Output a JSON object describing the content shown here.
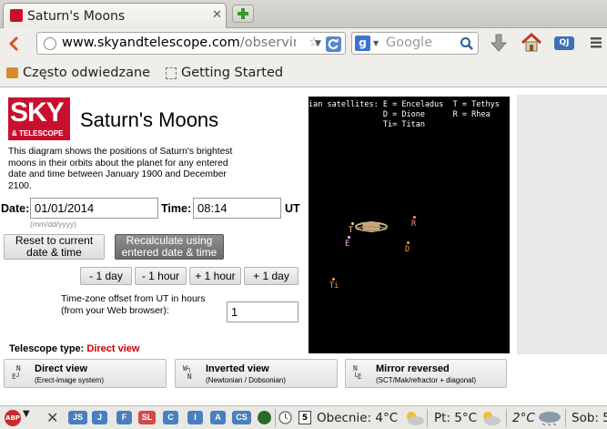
{
  "browser": {
    "tab_title": "Saturn's Moons",
    "url_host": "www.skyandtelescope.com",
    "url_path": "/observir",
    "search_placeholder": "Google",
    "bookmarks": [
      "Często odwiedzane",
      "Getting Started"
    ],
    "toolbar_badge": "QJ"
  },
  "page": {
    "logo_top": "SKY",
    "logo_bottom": "& TELESCOPE",
    "title": "Saturn's Moons",
    "description": "This diagram shows the positions of Saturn's brightest moons in their orbits about the planet for any entered date and time between January 1900 and December 2100.",
    "date_label": "Date:",
    "date_value": "01/01/2014",
    "date_hint": "(mm/dd/yyyy)",
    "time_label": "Time:",
    "time_value": "08:14",
    "time_unit": "UT",
    "reset_button": "Reset to current date & time",
    "recalc_button": "Recalculate using entered date & time",
    "step_buttons": [
      "- 1 day",
      "- 1 hour",
      "+ 1 hour",
      "+ 1 day"
    ],
    "tz_label": "Time-zone offset from UT in hours (from your Web browser):",
    "tz_value": "1",
    "scope_type_label": "Telescope type:",
    "scope_type_value": "Direct view",
    "view_buttons": [
      {
        "title": "Direct view",
        "sub": "(Erect-image system)"
      },
      {
        "title": "Inverted view",
        "sub": "(Newtonian / Dobsonian)"
      },
      {
        "title": "Mirror reversed",
        "sub": "(SCT/Mak/refractor + diagonal)"
      }
    ]
  },
  "sky_plot": {
    "legend_lines": [
      "ian satellites: E = Enceladus  T = Tethys",
      "                D = Dione      R = Rhea",
      "                Ti= Titan"
    ],
    "moons": [
      {
        "label": "T",
        "color": "#ffd27a"
      },
      {
        "label": "E",
        "color": "#ffb0ff"
      },
      {
        "label": "R",
        "color": "#ff8a8a"
      },
      {
        "label": "D",
        "color": "#ff9a3a"
      },
      {
        "label": "Ti",
        "color": "#ffa04a"
      }
    ]
  },
  "statusbar": {
    "chips": [
      "JS",
      "J",
      "F",
      "SL",
      "C",
      "I",
      "A",
      "CS"
    ],
    "calendar_day": "5",
    "weather_now": "Obecnie: 4°C",
    "weather_fri": "Pt: 5°C",
    "weather_2": "2°C",
    "weather_sat": "Sob: 5"
  }
}
